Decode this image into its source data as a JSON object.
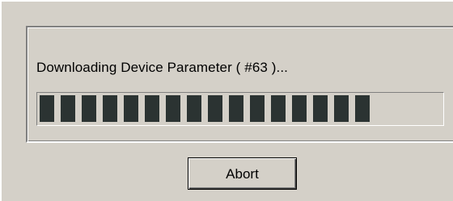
{
  "dialog": {
    "status_text": "Downloading Device Parameter ( #63 )...",
    "progress": {
      "filled_segments": 16,
      "total_segments": 19,
      "fraction": 0.84,
      "bar_color": "#2b3332"
    },
    "abort_label": "Abort"
  },
  "colors": {
    "face": "#d4d0c8",
    "shadow": "#808080",
    "highlight": "#ffffff"
  }
}
